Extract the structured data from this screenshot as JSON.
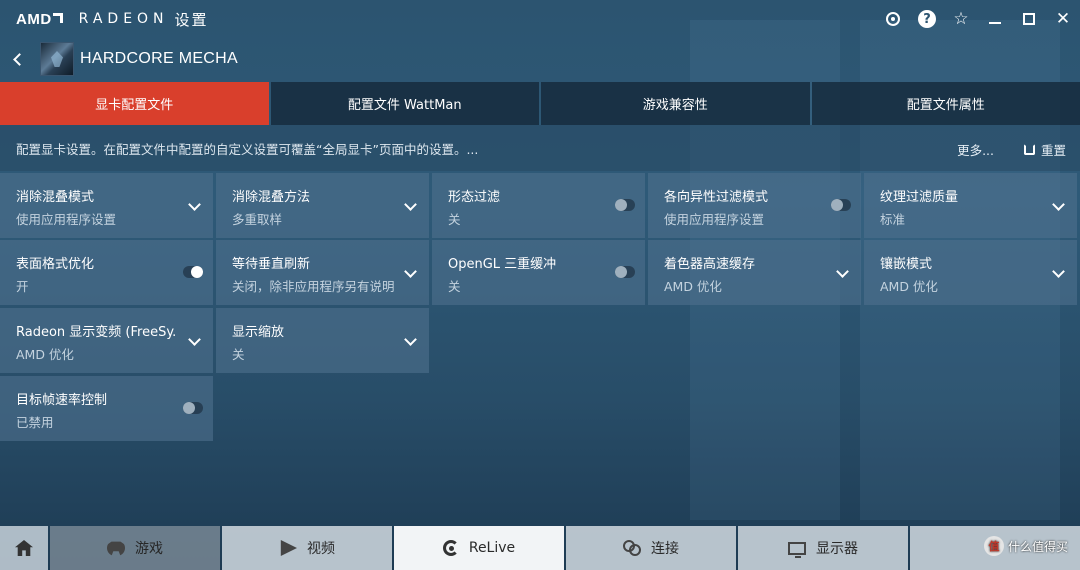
{
  "titlebar": {
    "brand": "AMD",
    "product": "RADEON",
    "section": "设置",
    "icons": [
      "sync-icon",
      "help-icon",
      "star-icon",
      "minimize-icon",
      "maximize-icon",
      "close-icon"
    ],
    "help_glyph": "?",
    "star_glyph": "☆",
    "close_glyph": "✕"
  },
  "profile": {
    "title": "HARDCORE MECHA"
  },
  "tabs": [
    {
      "label": "显卡配置文件",
      "active": true
    },
    {
      "label": "配置文件 WattMan",
      "active": false
    },
    {
      "label": "游戏兼容性",
      "active": false
    },
    {
      "label": "配置文件属性",
      "active": false
    }
  ],
  "info": {
    "text": "配置显卡设置。在配置文件中配置的自定义设置可覆盖“全局显卡”页面中的设置。...",
    "more": "更多...",
    "reset": "重置"
  },
  "settings": [
    {
      "title": "消除混叠模式",
      "value": "使用应用程序设置",
      "control": "dropdown"
    },
    {
      "title": "消除混叠方法",
      "value": "多重取样",
      "control": "dropdown"
    },
    {
      "title": "形态过滤",
      "value": "关",
      "control": "toggle-off"
    },
    {
      "title": "各向异性过滤模式",
      "value": "使用应用程序设置",
      "control": "toggle-off"
    },
    {
      "title": "纹理过滤质量",
      "value": "标准",
      "control": "dropdown"
    },
    {
      "title": "表面格式优化",
      "value": "开",
      "control": "toggle-on"
    },
    {
      "title": "等待垂直刷新",
      "value": "关闭，除非应用程序另有说明",
      "control": "dropdown"
    },
    {
      "title": "OpenGL 三重缓冲",
      "value": "关",
      "control": "toggle-off"
    },
    {
      "title": "着色器高速缓存",
      "value": "AMD 优化",
      "control": "dropdown"
    },
    {
      "title": "镶嵌模式",
      "value": "AMD 优化",
      "control": "dropdown"
    },
    {
      "title": "Radeon 显示变频 (FreeSy...",
      "value": "AMD 优化",
      "control": "dropdown"
    },
    {
      "title": "显示缩放",
      "value": "关",
      "control": "dropdown"
    },
    {
      "title": "目标帧速率控制",
      "value": "已禁用",
      "control": "toggle-off"
    }
  ],
  "bottom_nav": [
    {
      "label": "游戏",
      "icon": "gamepad-icon",
      "active": true
    },
    {
      "label": "视频",
      "icon": "play-icon",
      "active": false
    },
    {
      "label": "ReLive",
      "icon": "relive-icon",
      "active": false
    },
    {
      "label": "连接",
      "icon": "connect-icon",
      "active": false
    },
    {
      "label": "显示器",
      "icon": "monitor-icon",
      "active": false
    }
  ],
  "watermark": {
    "badge": "值",
    "text": "什么值得买"
  }
}
